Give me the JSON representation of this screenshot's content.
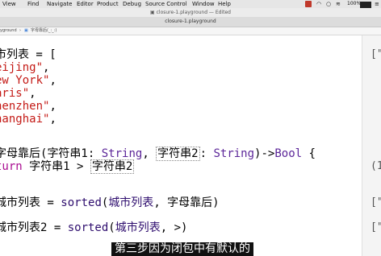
{
  "menubar": {
    "items": [
      "View",
      "Find",
      "Navigate",
      "Editor",
      "Product",
      "Debug",
      "Source Control",
      "Window",
      "Help"
    ],
    "battery": "100%"
  },
  "window_title": "closure-1.playground — Edited",
  "tab_title": "closure-1.playground",
  "jumpbar": {
    "file": "yground",
    "symbol": "字母靠后(_:_:)"
  },
  "code": {
    "line1_a": "市列表 = [",
    "str1": "eijing\"",
    "str2": "ew York\"",
    "str3": "aris\"",
    "str4": "henzhen\"",
    "str5": "hanghai\"",
    "comma": ",",
    "func_a": "字母靠后(",
    "func_p1": "字符串1",
    "func_colon1": ": ",
    "func_t1": "String",
    "func_comma": ", ",
    "func_p2": "字符串2",
    "func_colon2": ": ",
    "func_t2": "String",
    "func_arrow": ")->",
    "func_t3": "Bool",
    "func_brace": " {",
    "ret_kw": "turn",
    "ret_a": " 字符串1 > ",
    "ret_b": "字符串2",
    "sort1_a": "城市列表 = ",
    "sort1_fn": "sorted",
    "sort1_p": "(",
    "sort1_arg": "城市列表",
    "sort1_b": ", 字母靠后)",
    "sort2_a": "城市列表2 = ",
    "sort2_fn": "sorted",
    "sort2_p": "(",
    "sort2_arg": "城市列表",
    "sort2_b": ", >)"
  },
  "results": {
    "r1": "[\"",
    "r2": "(1",
    "r3": "[\"S",
    "r4": "[\"S"
  },
  "subtitle": "第三步因为闭包中有默认的"
}
